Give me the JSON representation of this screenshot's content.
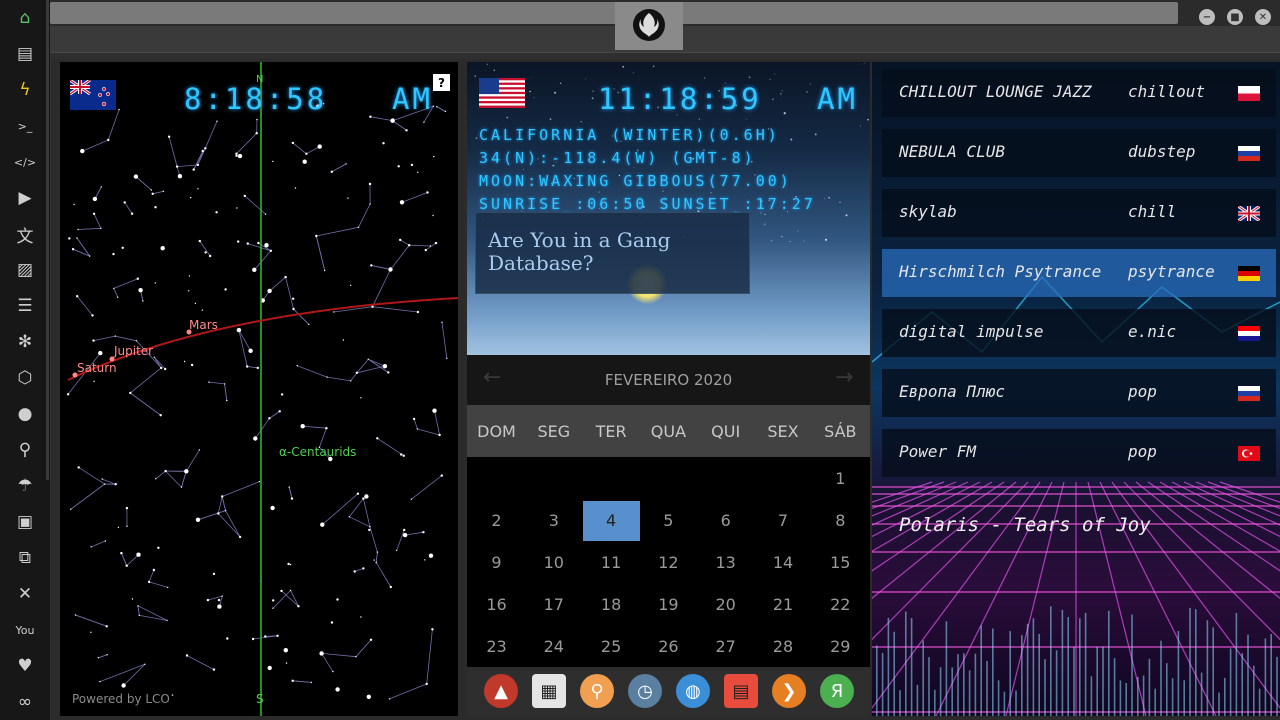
{
  "sidebar": {
    "items": [
      {
        "name": "home-icon",
        "glyph": "⌂"
      },
      {
        "name": "document-icon",
        "glyph": "▤"
      },
      {
        "name": "bolt-icon",
        "glyph": "ϟ"
      },
      {
        "name": "terminal-icon",
        "glyph": ">_"
      },
      {
        "name": "code-icon",
        "glyph": "</>"
      },
      {
        "name": "play-icon",
        "glyph": "▶"
      },
      {
        "name": "translate-icon",
        "glyph": "文"
      },
      {
        "name": "image-icon",
        "glyph": "▨"
      },
      {
        "name": "news-icon",
        "glyph": "☰"
      },
      {
        "name": "settings-cog-icon",
        "glyph": "✻"
      },
      {
        "name": "hexagon-icon",
        "glyph": "⬡"
      },
      {
        "name": "globe-icon",
        "glyph": "●"
      },
      {
        "name": "search-icon",
        "glyph": "⚲"
      },
      {
        "name": "umbrella-icon",
        "glyph": "☂"
      },
      {
        "name": "contact-icon",
        "glyph": "▣"
      },
      {
        "name": "link-icon",
        "glyph": "⧉"
      },
      {
        "name": "expand-icon",
        "glyph": "✕"
      },
      {
        "name": "youtube-icon",
        "glyph": "You"
      },
      {
        "name": "heart-icon",
        "glyph": "♥"
      },
      {
        "name": "infinity-icon",
        "glyph": "∞"
      }
    ]
  },
  "window": {
    "minimize": "−",
    "maximize": "■",
    "close": "✕"
  },
  "nz_clock": {
    "time": "8:18:58",
    "ampm": "AM",
    "help": "?",
    "north": "N",
    "south": "S",
    "powered_by": "Powered by LCO",
    "labels": {
      "mars": "Mars",
      "jupiter": "Jupiter",
      "saturn": "Saturn",
      "centaurids": "α-Centaurids"
    }
  },
  "us_clock": {
    "time": "11:18:59",
    "ampm": "AM",
    "info": [
      "CALIFORNIA (WINTER)(0.6H)",
      "34(N):-118.4(W) (GMT-8)",
      "MOON:WAXING GIBBOUS(77.00)",
      "SUNRISE_:06:50 SUNSET_:17:27"
    ],
    "news": "Are You in a Gang Database?"
  },
  "calendar": {
    "month": "FEVEREIRO 2020",
    "prev": "←",
    "next": "→",
    "days": [
      "DOM",
      "SEG",
      "TER",
      "QUA",
      "QUI",
      "SEX",
      "SÁB"
    ],
    "weeks": [
      [
        "",
        "",
        "",
        "",
        "",
        "",
        "1"
      ],
      [
        "2",
        "3",
        "4",
        "5",
        "6",
        "7",
        "8"
      ],
      [
        "9",
        "10",
        "11",
        "12",
        "13",
        "14",
        "15"
      ],
      [
        "16",
        "17",
        "18",
        "19",
        "20",
        "21",
        "22"
      ],
      [
        "23",
        "24",
        "25",
        "26",
        "27",
        "28",
        "29"
      ]
    ],
    "today": "4"
  },
  "dock": [
    {
      "name": "dock-app-red-icon",
      "glyph": "▲",
      "color": "#c0392b"
    },
    {
      "name": "dock-news-icon",
      "glyph": "▦",
      "color": "#e5e5e5"
    },
    {
      "name": "dock-search-icon",
      "glyph": "⚲",
      "color": "#f0a050"
    },
    {
      "name": "dock-clock-icon",
      "glyph": "◷",
      "color": "#5a7fa0"
    },
    {
      "name": "dock-globe-icon",
      "glyph": "◍",
      "color": "#3a8fd8"
    },
    {
      "name": "dock-calendar-icon",
      "glyph": "▤",
      "color": "#e74c3c"
    },
    {
      "name": "dock-arrow-icon",
      "glyph": "❯",
      "color": "#e67e22"
    },
    {
      "name": "dock-yandex-icon",
      "glyph": "Я",
      "color": "#4caf50"
    }
  ],
  "radio": {
    "stations": [
      {
        "name": "CHILLOUT LOUNGE JAZZ",
        "genre": "chillout",
        "flag": "pl",
        "selected": false
      },
      {
        "name": "NEBULA CLUB",
        "genre": "dubstep",
        "flag": "ru",
        "selected": false
      },
      {
        "name": "skylab",
        "genre": "chill",
        "flag": "gb",
        "selected": false
      },
      {
        "name": "Hirschmilch Psytrance",
        "genre": "psytrance",
        "flag": "de",
        "selected": true
      },
      {
        "name": "digital impulse",
        "genre": "e.nic",
        "flag": "hr",
        "selected": false
      },
      {
        "name": "Европа Плюс",
        "genre": "pop",
        "flag": "ru",
        "selected": false
      },
      {
        "name": "Power FM",
        "genre": "pop",
        "flag": "tr",
        "selected": false
      }
    ],
    "now_playing": "Polaris - Tears of Joy"
  },
  "colors": {
    "clock_cyan": "#2ec8ff",
    "today_blue": "#5790cc",
    "selected_station": "#286ebe",
    "mars_orbit": "#b01818",
    "meridian_green": "#2fbf2f"
  }
}
